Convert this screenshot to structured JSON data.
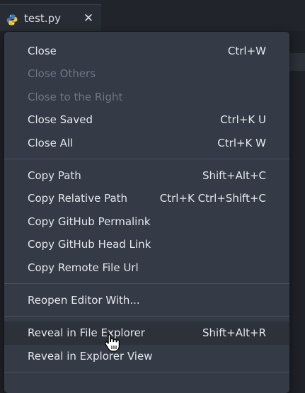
{
  "tab": {
    "title": "test.py",
    "icon": "python-icon",
    "close_icon": "close-icon"
  },
  "menu": {
    "items": [
      {
        "label": "Close",
        "shortcut": "Ctrl+W",
        "enabled": true
      },
      {
        "label": "Close Others",
        "shortcut": "",
        "enabled": false
      },
      {
        "label": "Close to the Right",
        "shortcut": "",
        "enabled": false
      },
      {
        "label": "Close Saved",
        "shortcut": "Ctrl+K U",
        "enabled": true
      },
      {
        "label": "Close All",
        "shortcut": "Ctrl+K W",
        "enabled": true
      },
      {
        "label": "Copy Path",
        "shortcut": "Shift+Alt+C",
        "enabled": true
      },
      {
        "label": "Copy Relative Path",
        "shortcut": "Ctrl+K Ctrl+Shift+C",
        "enabled": true
      },
      {
        "label": "Copy GitHub Permalink",
        "shortcut": "",
        "enabled": true
      },
      {
        "label": "Copy GitHub Head Link",
        "shortcut": "",
        "enabled": true
      },
      {
        "label": "Copy Remote File Url",
        "shortcut": "",
        "enabled": true
      },
      {
        "label": "Reopen Editor With...",
        "shortcut": "",
        "enabled": true
      },
      {
        "label": "Reveal in File Explorer",
        "shortcut": "Shift+Alt+R",
        "enabled": true,
        "hovered": true
      },
      {
        "label": "Reveal in Explorer View",
        "shortcut": "",
        "enabled": true
      }
    ]
  },
  "colors": {
    "menu_bg": "#343a46",
    "hover_bg": "#2c313a",
    "text": "#e4e7ec",
    "disabled_text": "#6f7684"
  }
}
